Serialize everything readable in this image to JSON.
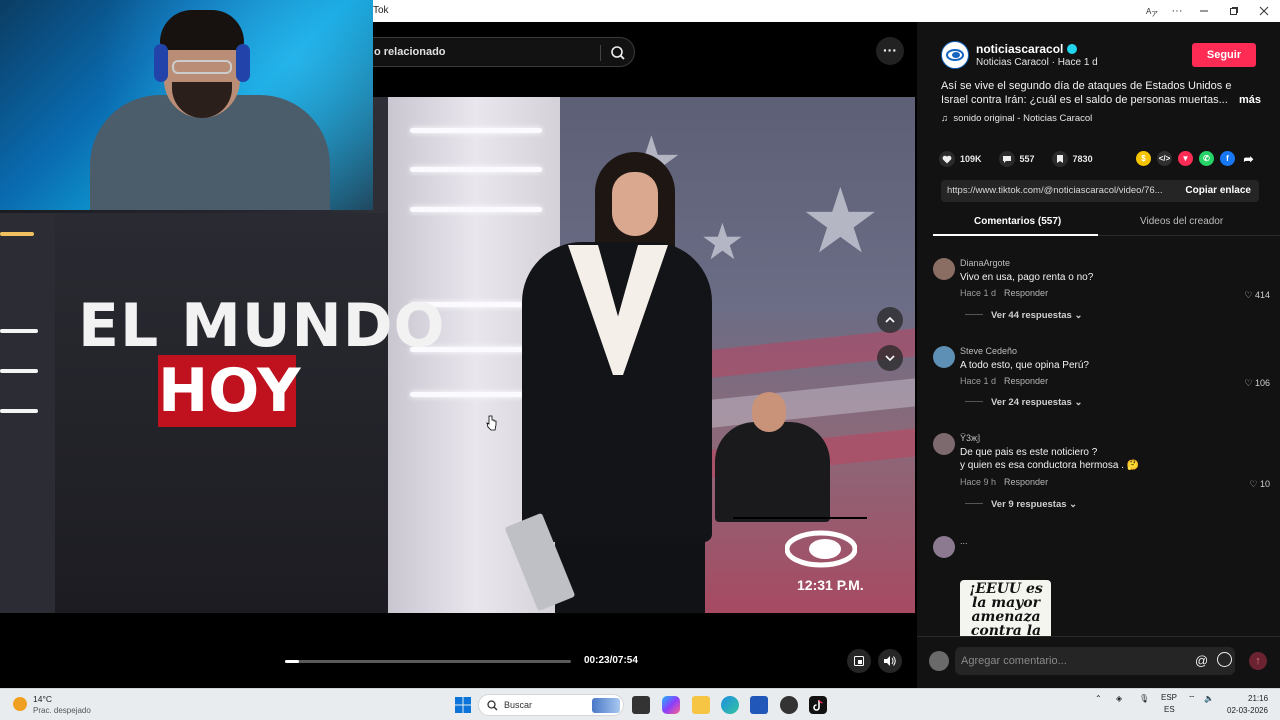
{
  "window": {
    "title": "Tok",
    "controls": [
      "translate-icon",
      "more-icon",
      "minimize-icon",
      "maximize-icon",
      "close-icon"
    ]
  },
  "player": {
    "search_text": "o relacionado",
    "video_title_line1": "EL MUNDO",
    "video_title_line2": "HOY",
    "clock_overlay": "12:31 P.M.",
    "time_display": "00:23/07:54",
    "progress_fraction": 0.049
  },
  "video_info": {
    "username": "noticiascaracol",
    "subline": "Noticias Caracol · Hace 1 d",
    "follow_label": "Seguir",
    "description_line1": "Así se vive el segundo día de ataques de Estados Unidos e",
    "description_line2": "Israel contra Irán: ¿cuál es el saldo de personas muertas...",
    "more_label": "más",
    "sound": "sonido original - Noticias Caracol",
    "likes": "109K",
    "comments_count": "557",
    "saves": "7830",
    "link": "https://www.tiktok.com/@noticiascaracol/video/76...",
    "copy_label": "Copiar enlace"
  },
  "tabs": {
    "comments": "Comentarios (557)",
    "creator": "Videos del creador"
  },
  "comments": [
    {
      "user": "DianaArgote",
      "text": "Vivo en usa, pago renta o no?",
      "time": "Hace 1 d",
      "reply": "Responder",
      "likes": "414",
      "replies": "Ver 44 respuestas",
      "avatar_color": "#8a6e64"
    },
    {
      "user": "Steve Cedeño",
      "text": "A todo esto, que opina Perú?",
      "time": "Hace 1 d",
      "reply": "Responder",
      "likes": "106",
      "replies": "Ver 24 respuestas",
      "avatar_color": "#5e8fb5"
    },
    {
      "user": "Ÿ3ж𝕁",
      "text": "De que pais es este noticiero ?",
      "text2": "y quien es esa conductora hermosa . 🤔",
      "time": "Hace 9 h",
      "reply": "Responder",
      "likes": "10",
      "replies": "Ver 9 respuestas",
      "avatar_color": "#7d6a6f"
    },
    {
      "user": "...",
      "sticker_text": "¡EEUU es la mayor amenaza contra la",
      "avatar_color": "#8b7a90"
    }
  ],
  "comment_bar": {
    "placeholder": "Agregar comentario..."
  },
  "taskbar": {
    "temp": "14°C",
    "weather": "Prac. despejado",
    "search": "Buscar",
    "lang1": "ESP",
    "lang2": "ES",
    "time": "21:16",
    "date": "02-03-2026"
  }
}
